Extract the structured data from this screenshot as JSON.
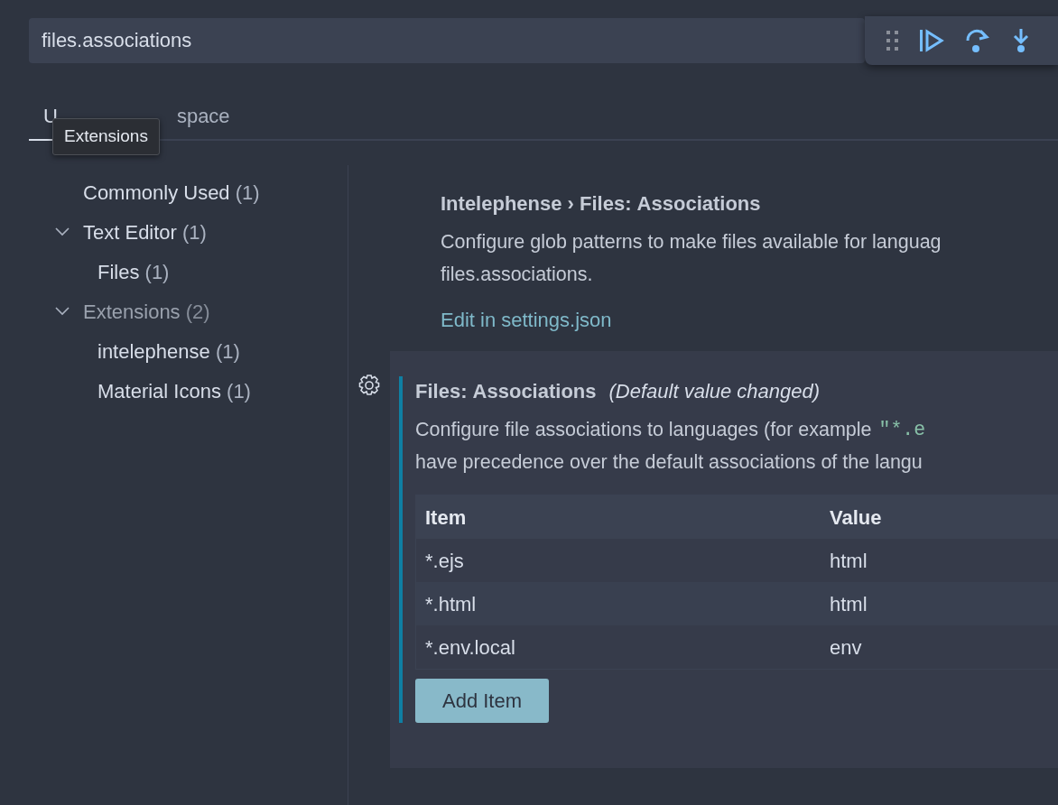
{
  "search": {
    "value": "files.associations"
  },
  "tabs": [
    {
      "label": "U",
      "selected": true
    },
    {
      "label": "space",
      "selected": false
    }
  ],
  "tooltip": "Extensions",
  "debug_toolbar": {
    "buttons": [
      {
        "kind": "continue"
      },
      {
        "kind": "step-over"
      },
      {
        "kind": "step-into"
      }
    ]
  },
  "tree": [
    {
      "label": "Commonly Used",
      "count": "(1)",
      "dimmed": false
    },
    {
      "label": "Text Editor",
      "count": "(1)",
      "dimmed": false,
      "expanded": true,
      "children": [
        {
          "label": "Files",
          "count": "(1)",
          "dimmed": false
        }
      ]
    },
    {
      "label": "Extensions",
      "count": "(2)",
      "dimmed": true,
      "expanded": true,
      "children": [
        {
          "label": "intelephense",
          "count": "(1)",
          "dimmed": false
        },
        {
          "label": "Material Icons",
          "count": "(1)",
          "dimmed": false
        }
      ]
    }
  ],
  "settings": [
    {
      "kind": "link",
      "title": "Intelephense › Files: **Associations**",
      "description": [
        "Configure glob patterns to make files available for languag",
        "files.associations."
      ],
      "link": "Edit in settings.json",
      "modified": false
    },
    {
      "kind": "table",
      "title": "Files: **Associations**",
      "note": "(Default value changed)",
      "description": [
        "Configure file associations to languages (for example",
        "have precedence over the default associations of the langu"
      ],
      "code": "\"*.e",
      "modified": true,
      "columns": [
        "Item",
        "Value"
      ],
      "rows": [
        [
          "*.ejs",
          "html"
        ],
        [
          "*.html",
          "html"
        ],
        [
          "*.env.local",
          "env"
        ]
      ],
      "button": "Add Item"
    }
  ]
}
